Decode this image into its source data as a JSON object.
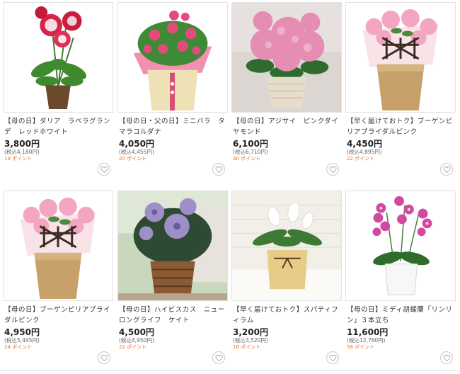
{
  "products": [
    {
      "title": "【母の日】ダリア　ラベラグランデ　レッドホワイト",
      "price": "3,800円",
      "tax": "(税込4,180円)",
      "points": "19 ポイント",
      "image": "red-dahlia-pot",
      "accent": "#d6254a"
    },
    {
      "title": "【母の日・父の日】ミニバラ　タマラコルダナ",
      "price": "4,050円",
      "tax": "(税込4,455円)",
      "points": "20 ポイント",
      "image": "pink-mini-rose-pot",
      "accent": "#e44b7c"
    },
    {
      "title": "【母の日】アジサイ　ピンクダイヤモンド",
      "price": "6,100円",
      "tax": "(税込6,710円)",
      "points": "30 ポイント",
      "image": "pink-hydrangea-basket",
      "accent": "#e58db3"
    },
    {
      "title": "【早く届けておトク】ブーゲンビリアブライダルピンク",
      "price": "4,450円",
      "tax": "(税込4,895円)",
      "points": "22 ポイント",
      "image": "bougainvillea-pot",
      "accent": "#f2a6c0"
    },
    {
      "title": "【母の日】ブーゲンビリアブライダルピンク",
      "price": "4,950円",
      "tax": "(税込5,445円)",
      "points": "24 ポイント",
      "image": "bougainvillea-pot",
      "accent": "#f2a6c0"
    },
    {
      "title": "【母の日】ハイビスカス　ニューロングライフ　ケイト",
      "price": "4,500円",
      "tax": "(税込4,950円)",
      "points": "22 ポイント",
      "image": "purple-hibiscus-basket",
      "accent": "#9f8fc9"
    },
    {
      "title": "【早く届けておトク】スパティフィラム",
      "price": "3,200円",
      "tax": "(税込3,520円)",
      "points": "16 ポイント",
      "image": "spathiphyllum-pot",
      "accent": "#f3f3ee"
    },
    {
      "title": "【母の日】ミディ胡蝶蘭「リンリン」３本立ち",
      "price": "11,600円",
      "tax": "(税込12,760円)",
      "points": "58 ポイント",
      "image": "orchid-pot",
      "accent": "#d24aa0"
    }
  ],
  "colors": {
    "points": "#e8722d",
    "text": "#333333",
    "border": "#e2e2e2"
  },
  "icons": {
    "favorite": "heart-outline-icon"
  }
}
